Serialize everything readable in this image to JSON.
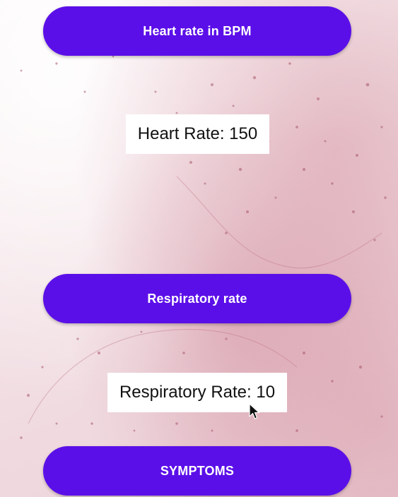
{
  "buttons": {
    "heart_rate": "Heart rate in BPM",
    "respiratory_rate": "Respiratory rate",
    "symptoms": "SYMPTOMS"
  },
  "readings": {
    "heart_rate": "Heart Rate: 150",
    "respiratory_rate": "Respiratory Rate: 10"
  },
  "colors": {
    "button": "#5b0fe8",
    "button_text": "#ffffff",
    "value_box": "#ffffff"
  },
  "icons": {
    "cursor": "mouse-pointer-icon"
  }
}
